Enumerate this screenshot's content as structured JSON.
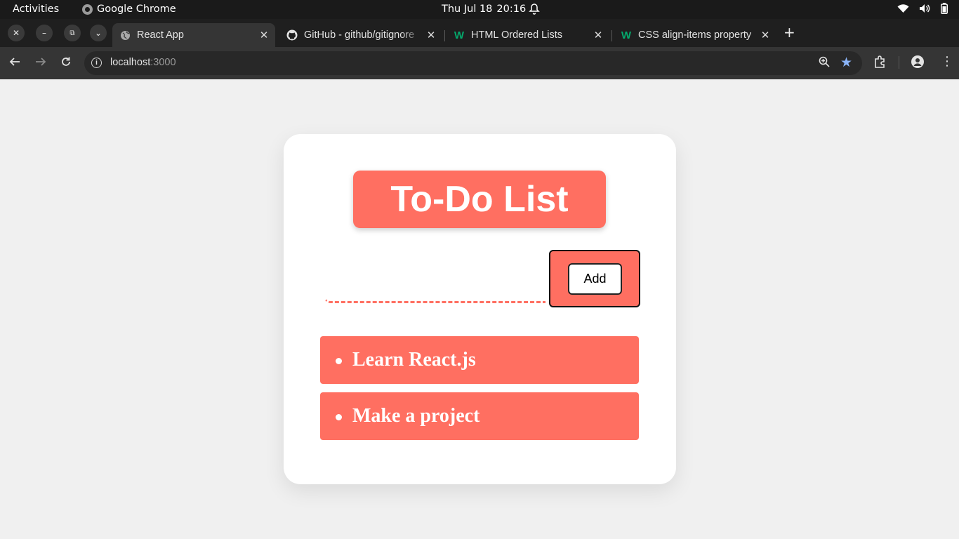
{
  "system_bar": {
    "activities": "Activities",
    "app_name": "Google Chrome",
    "date": "Thu Jul 18",
    "time": "20:16"
  },
  "tabs": [
    {
      "title": "React App",
      "icon": "globe-icon",
      "active": true
    },
    {
      "title": "GitHub - github/gitignore",
      "icon": "github-icon",
      "active": false
    },
    {
      "title": "HTML Ordered Lists",
      "icon": "w3schools-icon",
      "active": false
    },
    {
      "title": "CSS align-items property",
      "icon": "w3schools-icon",
      "active": false
    }
  ],
  "address_bar": {
    "host": "localhost",
    "port": ":3000"
  },
  "app": {
    "title": "To-Do List",
    "input_value": "",
    "add_label": "Add",
    "accent_color": "#ff6f61",
    "todos": [
      {
        "text": "Learn React.js"
      },
      {
        "text": "Make a project"
      }
    ]
  }
}
